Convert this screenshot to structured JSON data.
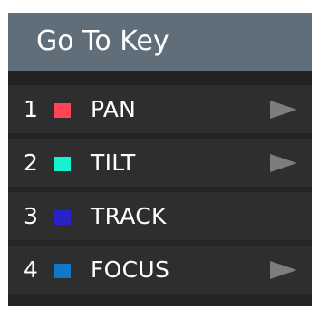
{
  "header": {
    "title": "Go To Key"
  },
  "keys": [
    {
      "number": "1",
      "label": "PAN",
      "color": "#ff4458",
      "has_arrow": true,
      "arrow_icon": "play-right-icon"
    },
    {
      "number": "2",
      "label": "TILT",
      "color": "#16f2d0",
      "has_arrow": true,
      "arrow_icon": "play-right-icon"
    },
    {
      "number": "3",
      "label": "TRACK",
      "color": "#2a22c9",
      "has_arrow": false
    },
    {
      "number": "4",
      "label": "FOCUS",
      "color": "#0f78c8",
      "has_arrow": true,
      "arrow_icon": "play-right-icon"
    }
  ],
  "theme": {
    "panel_bg": "#252525",
    "header_bg": "#5f6e78",
    "row_bg": "#2e2e2e",
    "text": "#ffffff",
    "arrow_fill": "#7d7d7d"
  }
}
